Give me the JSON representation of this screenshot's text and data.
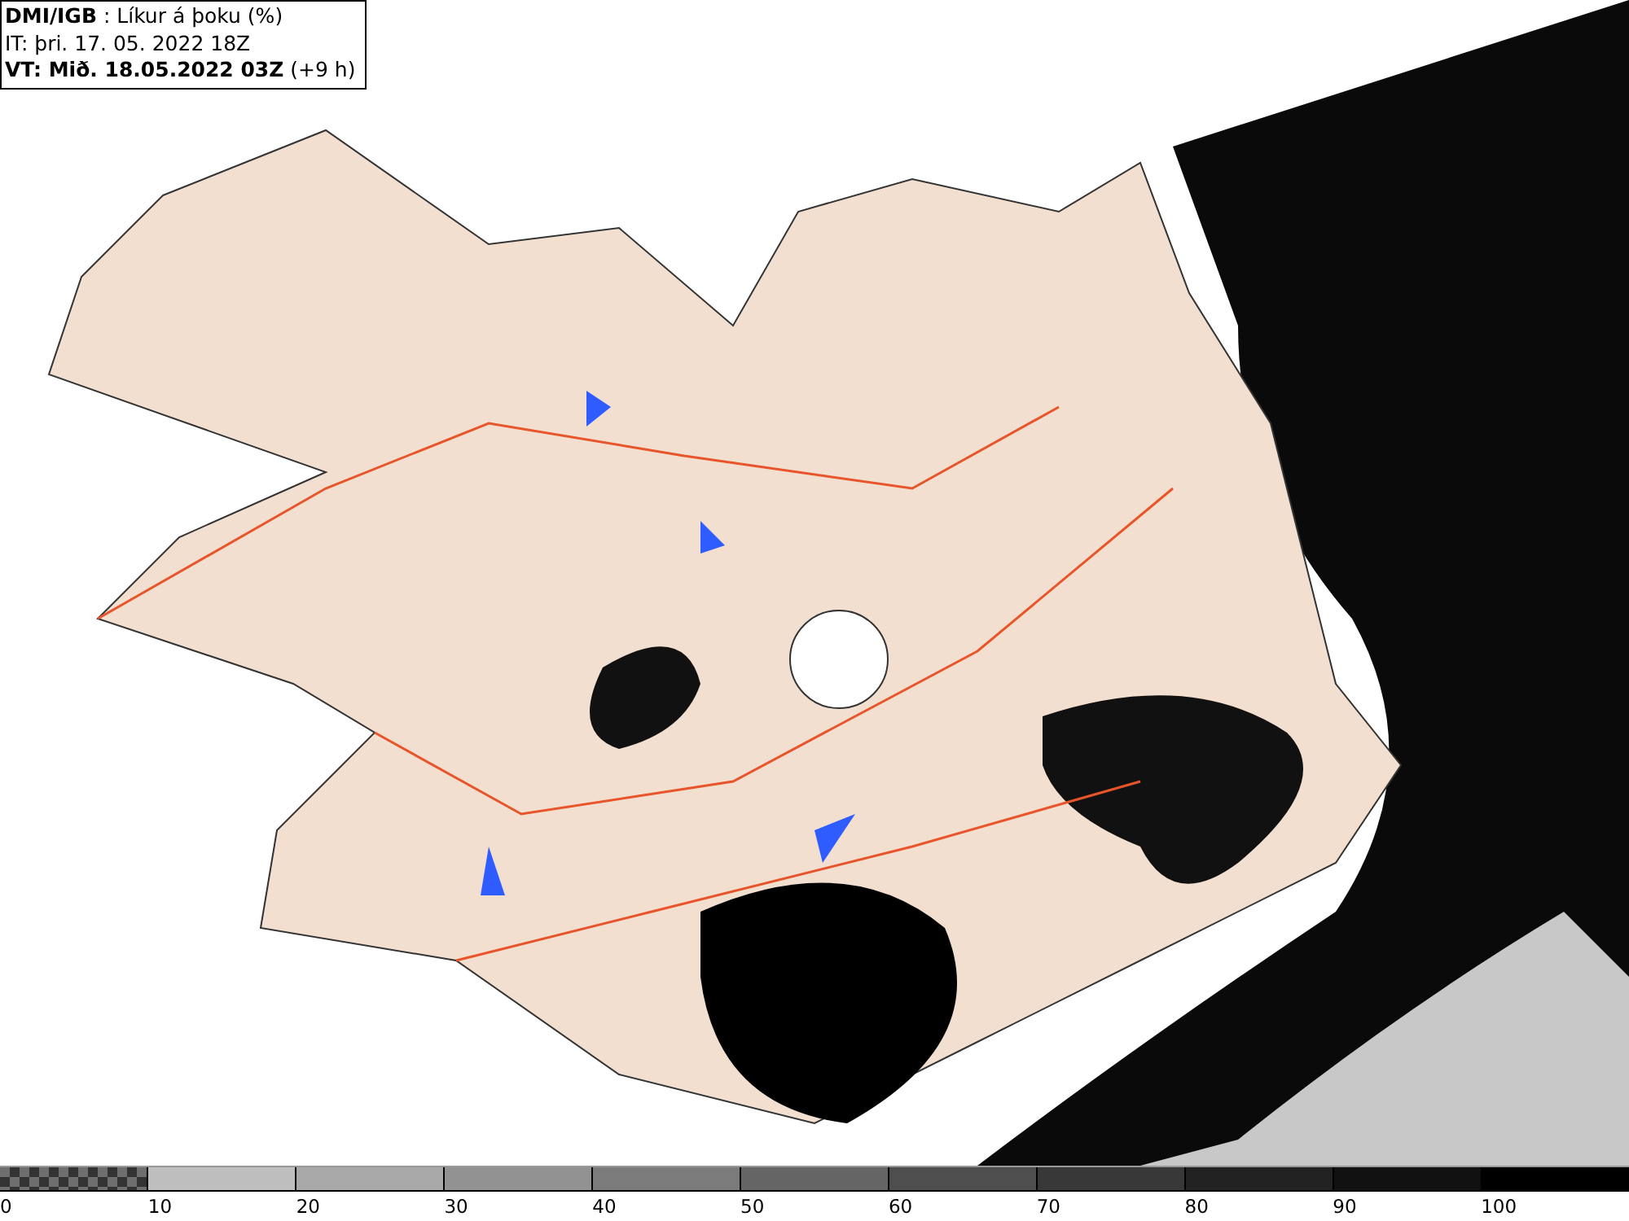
{
  "title_box": {
    "lines": [
      "**DMI/IGB** : Líkur á þoku (%)",
      "IT: þri. 17. 05. 2022 18Z",
      "**VT: Mið. 18.05.2022 03Z** (+9 h)"
    ]
  },
  "legend": {
    "segments": [
      {
        "label": "0",
        "kind": "checker",
        "color": "#6e6e6e"
      },
      {
        "label": "10",
        "kind": "solid",
        "color": "#bebebe"
      },
      {
        "label": "20",
        "kind": "solid",
        "color": "#a8a8a8"
      },
      {
        "label": "30",
        "kind": "solid",
        "color": "#929292"
      },
      {
        "label": "40",
        "kind": "solid",
        "color": "#7b7b7b"
      },
      {
        "label": "50",
        "kind": "solid",
        "color": "#656565"
      },
      {
        "label": "60",
        "kind": "solid",
        "color": "#4e4e4e"
      },
      {
        "label": "70",
        "kind": "solid",
        "color": "#383838"
      },
      {
        "label": "80",
        "kind": "solid",
        "color": "#222222"
      },
      {
        "label": "90",
        "kind": "solid",
        "color": "#111111"
      },
      {
        "label": "100",
        "kind": "solid",
        "color": "#000000"
      }
    ]
  }
}
